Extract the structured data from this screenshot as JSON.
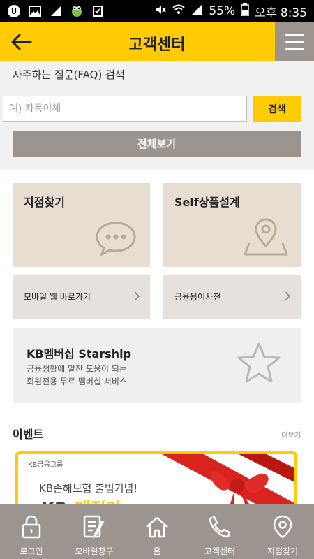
{
  "status_bar": {
    "battery": "55%",
    "time": "오후 8:35"
  },
  "header": {
    "title": "고객센터"
  },
  "search": {
    "label": "자주하는 질문(FAQ) 검색",
    "placeholder": "예) 자동이체",
    "button_label": "검색",
    "view_all_label": "전체보기"
  },
  "tiles": {
    "branch_label": "지점찾기",
    "self_product_label": "Self상품설계",
    "mobile_web_label": "모바일 웹 바로가기",
    "dictionary_label": "금융용어사전"
  },
  "kb_card": {
    "title": "KB멤버십 Starship",
    "desc_line1": "금융생활에 알찬 도움이 되는",
    "desc_line2": "회원전용 무료 멤버십 서비스"
  },
  "events": {
    "title": "이벤트",
    "more_label": "더보기",
    "banner": {
      "group": "KB금융그룹",
      "headline": "KB손해보험 출범기념!",
      "brand_prefix": "KB ",
      "brand_name": "매직카"
    }
  },
  "bottom_nav": [
    {
      "label": "로그인",
      "icon": "lock-icon"
    },
    {
      "label": "모바일창구",
      "icon": "document-pen-icon"
    },
    {
      "label": "홈",
      "icon": "home-icon"
    },
    {
      "label": "고객센터",
      "icon": "phone-icon"
    },
    {
      "label": "지점찾기",
      "icon": "location-pin-icon"
    }
  ],
  "colors": {
    "accent_yellow": "#ffcb05",
    "taupe": "#9c948e",
    "tile_beige": "#e7ddd0"
  }
}
